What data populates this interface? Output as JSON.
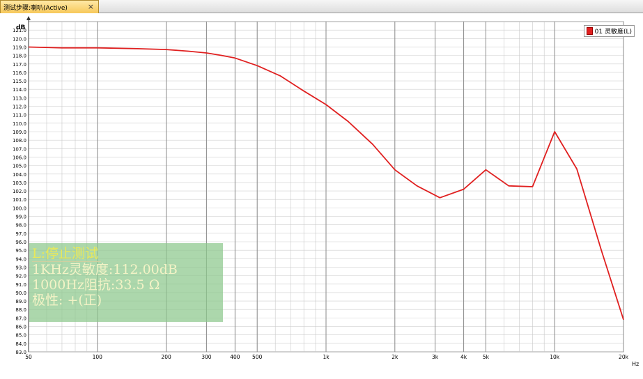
{
  "tab": {
    "title": "测试步骤:喇叭(Active)",
    "close_label": "×"
  },
  "info_box": {
    "status": "L:停止测试",
    "sensitivity": "1KHz灵敏度:112.00dB",
    "impedance": "1000Hz阻抗:33.5  Ω",
    "polarity": "极性: +(正)"
  },
  "colors": {
    "line": "#e02020",
    "grid": "#bdbdbd",
    "info_box_bg": "#8cc88c"
  },
  "chart_data": {
    "type": "line",
    "title": "",
    "xlabel": "Hz",
    "ylabel": "dB",
    "xscale": "log",
    "xlim": [
      50,
      20000
    ],
    "ylim": [
      83,
      122
    ],
    "grid": true,
    "legend_position": "top-right",
    "x_tick_labels": [
      "50",
      "100",
      "200",
      "300",
      "400",
      "500",
      "1k",
      "2k",
      "3k",
      "4k",
      "5k",
      "10k",
      "20k",
      "Hz"
    ],
    "x_tick_values": [
      50,
      100,
      200,
      300,
      400,
      500,
      1000,
      2000,
      3000,
      4000,
      5000,
      10000,
      20000
    ],
    "y_tick_labels": [
      "121.0",
      "120.0",
      "119.0",
      "118.0",
      "117.0",
      "116.0",
      "115.0",
      "114.0",
      "113.0",
      "112.0",
      "111.0",
      "110.0",
      "109.0",
      "108.0",
      "107.0",
      "106.0",
      "105.0",
      "104.0",
      "103.0",
      "102.0",
      "101.0",
      "100.0",
      "99.0",
      "98.0",
      "97.0",
      "96.0",
      "95.0",
      "94.0",
      "93.0",
      "92.0",
      "91.0",
      "90.0",
      "89.0",
      "88.0",
      "87.0",
      "86.0",
      "85.0",
      "84.0",
      "83.0"
    ],
    "series": [
      {
        "name": "01 灵敏度(L)",
        "color": "#e02020",
        "x": [
          50,
          70,
          100,
          150,
          200,
          250,
          300,
          350,
          400,
          500,
          630,
          800,
          1000,
          1250,
          1600,
          2000,
          2500,
          3150,
          4000,
          5000,
          6300,
          8000,
          10000,
          12500,
          16000,
          20000
        ],
        "y": [
          119.0,
          118.9,
          118.9,
          118.8,
          118.7,
          118.5,
          118.3,
          118.0,
          117.7,
          116.8,
          115.6,
          113.8,
          112.2,
          110.2,
          107.5,
          104.5,
          102.6,
          101.2,
          102.2,
          104.5,
          102.6,
          102.5,
          109.0,
          104.6,
          95.0,
          86.8
        ]
      }
    ]
  }
}
